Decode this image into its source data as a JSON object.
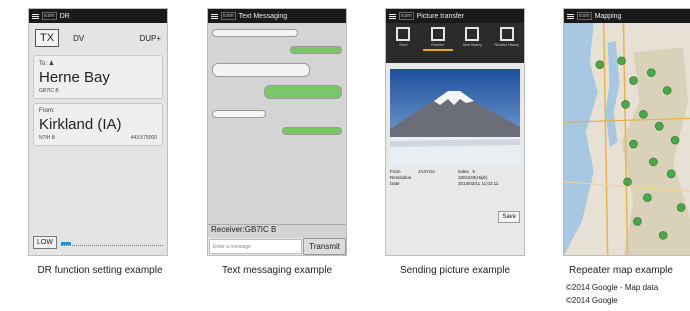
{
  "phones": {
    "dr": {
      "app_title": "DR",
      "tx_label": "TX",
      "mode": "DV",
      "duplex": "DUP+",
      "to_label": "To:",
      "to_name": "Herne Bay",
      "to_call": "GB7IC B",
      "from_label": "From:",
      "from_name": "Kirkland (IA)",
      "from_call": "N7IH  B",
      "from_freq": "443.575000",
      "power_label": "LOW",
      "signal_level": 0.1
    },
    "messaging": {
      "app_title": "Text Messaging",
      "receiver": "Receiver:GB7IC B",
      "input_placeholder": "Enter a message",
      "transmit_label": "Transmit"
    },
    "picture": {
      "app_title": "Picture transfer",
      "tabs": [
        {
          "label": "Send",
          "icon": "picture-send-icon"
        },
        {
          "label": "Receive",
          "icon": "picture-receive-icon"
        },
        {
          "label": "Sent History",
          "icon": "sent-history-icon"
        },
        {
          "label": "Receive History",
          "icon": "receive-history-icon"
        }
      ],
      "from_label": "From",
      "from_value": "JA3YUA",
      "index_label": "index",
      "index_value": "5",
      "resolution_label": "Resolution",
      "resolution_value": "320x240(High)",
      "date_label": "Date",
      "date_value": "2014/03/11 11:03:11",
      "save_label": "Save"
    },
    "map": {
      "app_title": "Mapping"
    }
  },
  "captions": {
    "dr": "DR function setting example",
    "messaging": "Text messaging example",
    "picture": "Sending picture example",
    "map": "Repeater map example"
  },
  "credits": {
    "line1": "©2014 Google - Map data",
    "line2": "©2014 Google"
  },
  "colors": {
    "message_out": "#7cc66a",
    "tab_active": "#f0a11b",
    "signal": "#2a8fd6"
  }
}
